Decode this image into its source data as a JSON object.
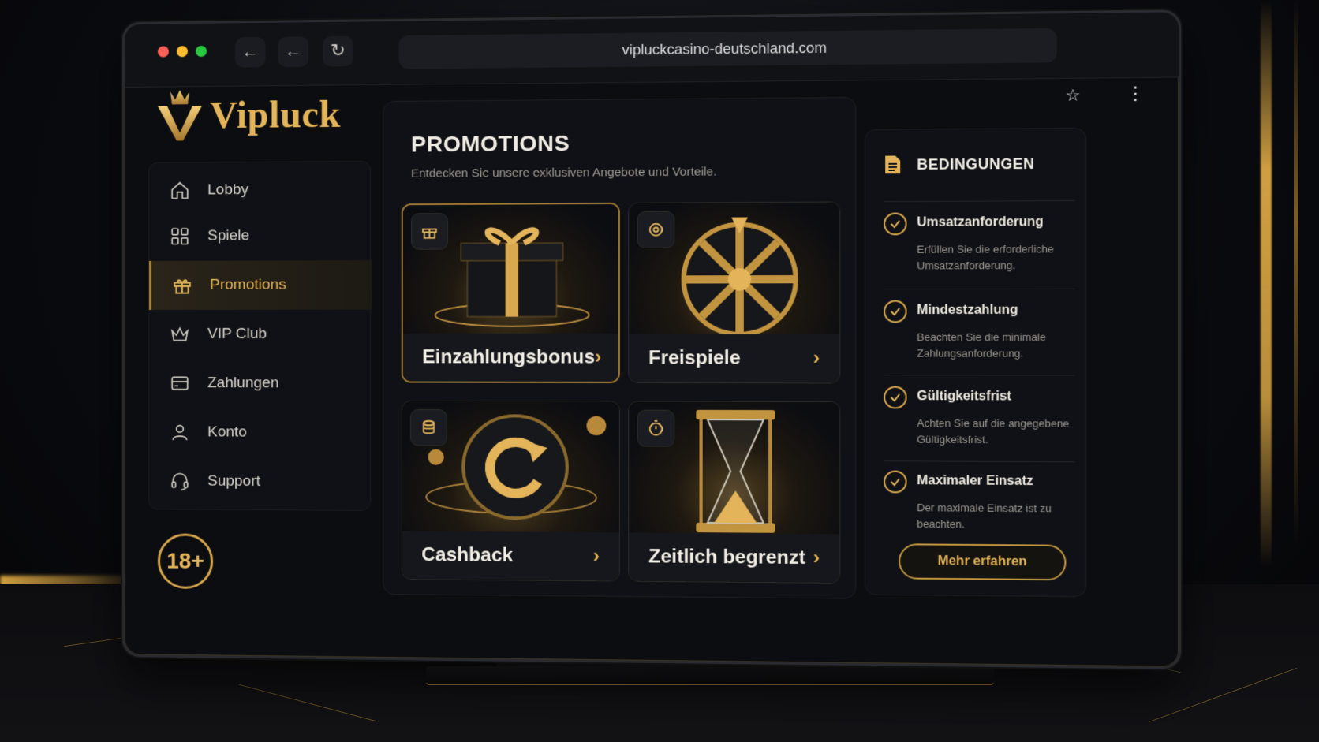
{
  "browser": {
    "url": "vipluckcasino-deutschland.com"
  },
  "brand": {
    "name": "Vipluck",
    "accent": "#e3b45a",
    "age_badge": "18+"
  },
  "sidebar": {
    "items": [
      {
        "label": "Lobby",
        "icon": "home-icon"
      },
      {
        "label": "Spiele",
        "icon": "grid-icon"
      },
      {
        "label": "Promotions",
        "icon": "gift-icon",
        "active": true
      },
      {
        "label": "VIP Club",
        "icon": "crown-icon"
      },
      {
        "label": "Zahlungen",
        "icon": "card-icon"
      },
      {
        "label": "Konto",
        "icon": "user-icon"
      },
      {
        "label": "Support",
        "icon": "headset-icon"
      }
    ]
  },
  "promotions": {
    "title": "PROMOTIONS",
    "subtitle": "Entdecken Sie unsere exklusiven Angebote und Vorteile.",
    "cards": [
      {
        "label": "Einzahlungsbonus",
        "icon": "gift-icon"
      },
      {
        "label": "Freispiele",
        "icon": "wheel-icon"
      },
      {
        "label": "Cashback",
        "icon": "coins-icon"
      },
      {
        "label": "Zeitlich begrenzt",
        "icon": "stopwatch-icon"
      }
    ]
  },
  "conditions": {
    "title": "BEDINGUNGEN",
    "items": [
      {
        "name": "Umsatzanforderung",
        "desc": "Erfüllen Sie die erforderliche Umsatzanforderung."
      },
      {
        "name": "Mindestzahlung",
        "desc": "Beachten Sie die minimale Zahlungsanforderung."
      },
      {
        "name": "Gültigkeitsfrist",
        "desc": "Achten Sie auf die angegebene Gültigkeitsfrist."
      },
      {
        "name": "Maximaler Einsatz",
        "desc": "Der maximale Einsatz ist zu beachten."
      }
    ],
    "button": "Mehr erfahren"
  }
}
